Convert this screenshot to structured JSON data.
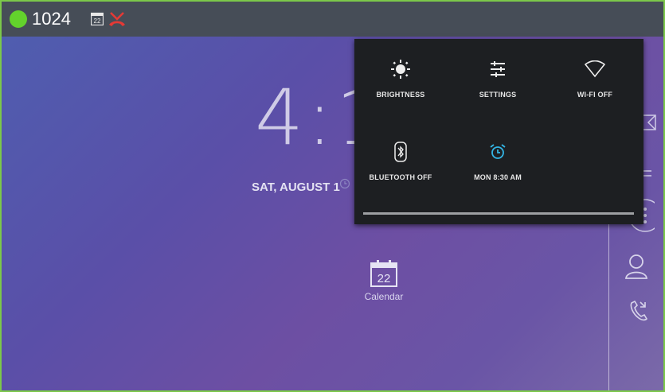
{
  "status_bar": {
    "number": "1024",
    "calendar_day": "22"
  },
  "lockscreen": {
    "time": "4:1",
    "date": "SAT, AUGUST 1"
  },
  "quick_settings": {
    "tiles": [
      {
        "label": "BRIGHTNESS",
        "icon": "brightness-icon"
      },
      {
        "label": "SETTINGS",
        "icon": "settings-sliders-icon"
      },
      {
        "label": "WI-FI OFF",
        "icon": "wifi-off-icon"
      },
      {
        "label": "BLUETOOTH OFF",
        "icon": "bluetooth-off-icon"
      },
      {
        "label": "MON 8:30 AM",
        "icon": "alarm-icon"
      }
    ],
    "alarm_color": "#33b5e5"
  },
  "desktop": {
    "calendar_label": "Calendar",
    "calendar_day": "22"
  },
  "colors": {
    "status_dot": "#63d22c",
    "frame": "#7cc84a",
    "missed_call": "#e53935"
  }
}
